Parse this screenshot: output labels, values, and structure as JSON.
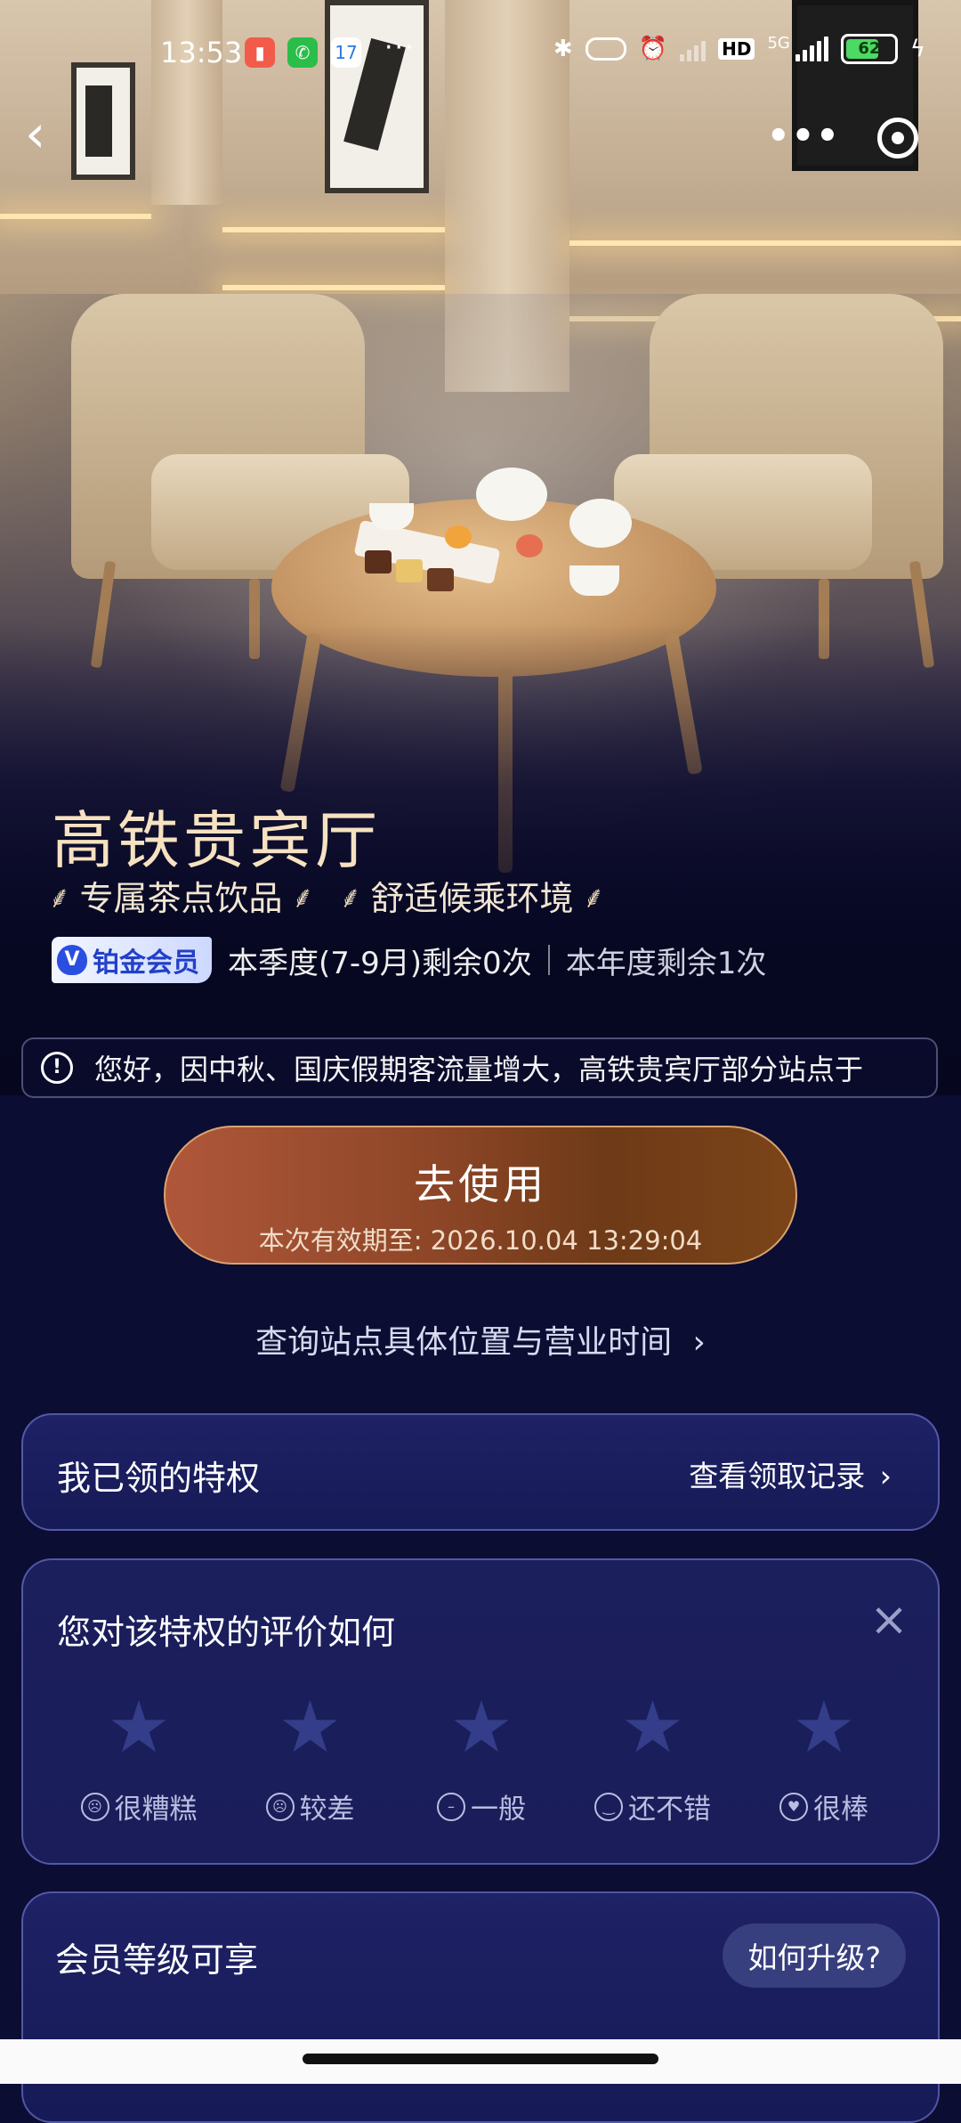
{
  "status_bar": {
    "time": "13:53",
    "more": "···",
    "calendar_day": "17",
    "network": "5G",
    "hd": "HD",
    "battery": "62"
  },
  "nav": {
    "back_icon": "chevron-left-icon",
    "more_icon": "more-icon",
    "close_icon": "target-icon"
  },
  "hero": {
    "title": "高铁贵宾厅",
    "perks": [
      "专属茶点饮品",
      "舒适候乘环境"
    ],
    "badge": "铂金会员",
    "quarter_remaining": "本季度(7-9月)剩余0次",
    "year_remaining": "本年度剩余1次"
  },
  "notice": {
    "text": "您好，因中秋、国庆假期客流量增大，高铁贵宾厅部分站点于"
  },
  "cta": {
    "label": "去使用",
    "validity": "本次有效期至: 2026.10.04 13:29:04"
  },
  "query_link": "查询站点具体位置与营业时间",
  "privilege": {
    "label": "我已领的特权",
    "link": "查看领取记录"
  },
  "rating": {
    "label": "您对该特权的评价如何",
    "options": [
      {
        "label": "很糟糕",
        "face": "☹"
      },
      {
        "label": "较差",
        "face": "☹"
      },
      {
        "label": "一般",
        "face": "–"
      },
      {
        "label": "还不错",
        "face": "‿"
      },
      {
        "label": "很棒",
        "face": "♥"
      }
    ]
  },
  "tier": {
    "label": "会员等级可享",
    "upgrade": "如何升级?"
  },
  "colors": {
    "background": "#0b0d33",
    "title": "#f6e2c0",
    "cta": "#8b4526",
    "card": "#1a1d59"
  }
}
